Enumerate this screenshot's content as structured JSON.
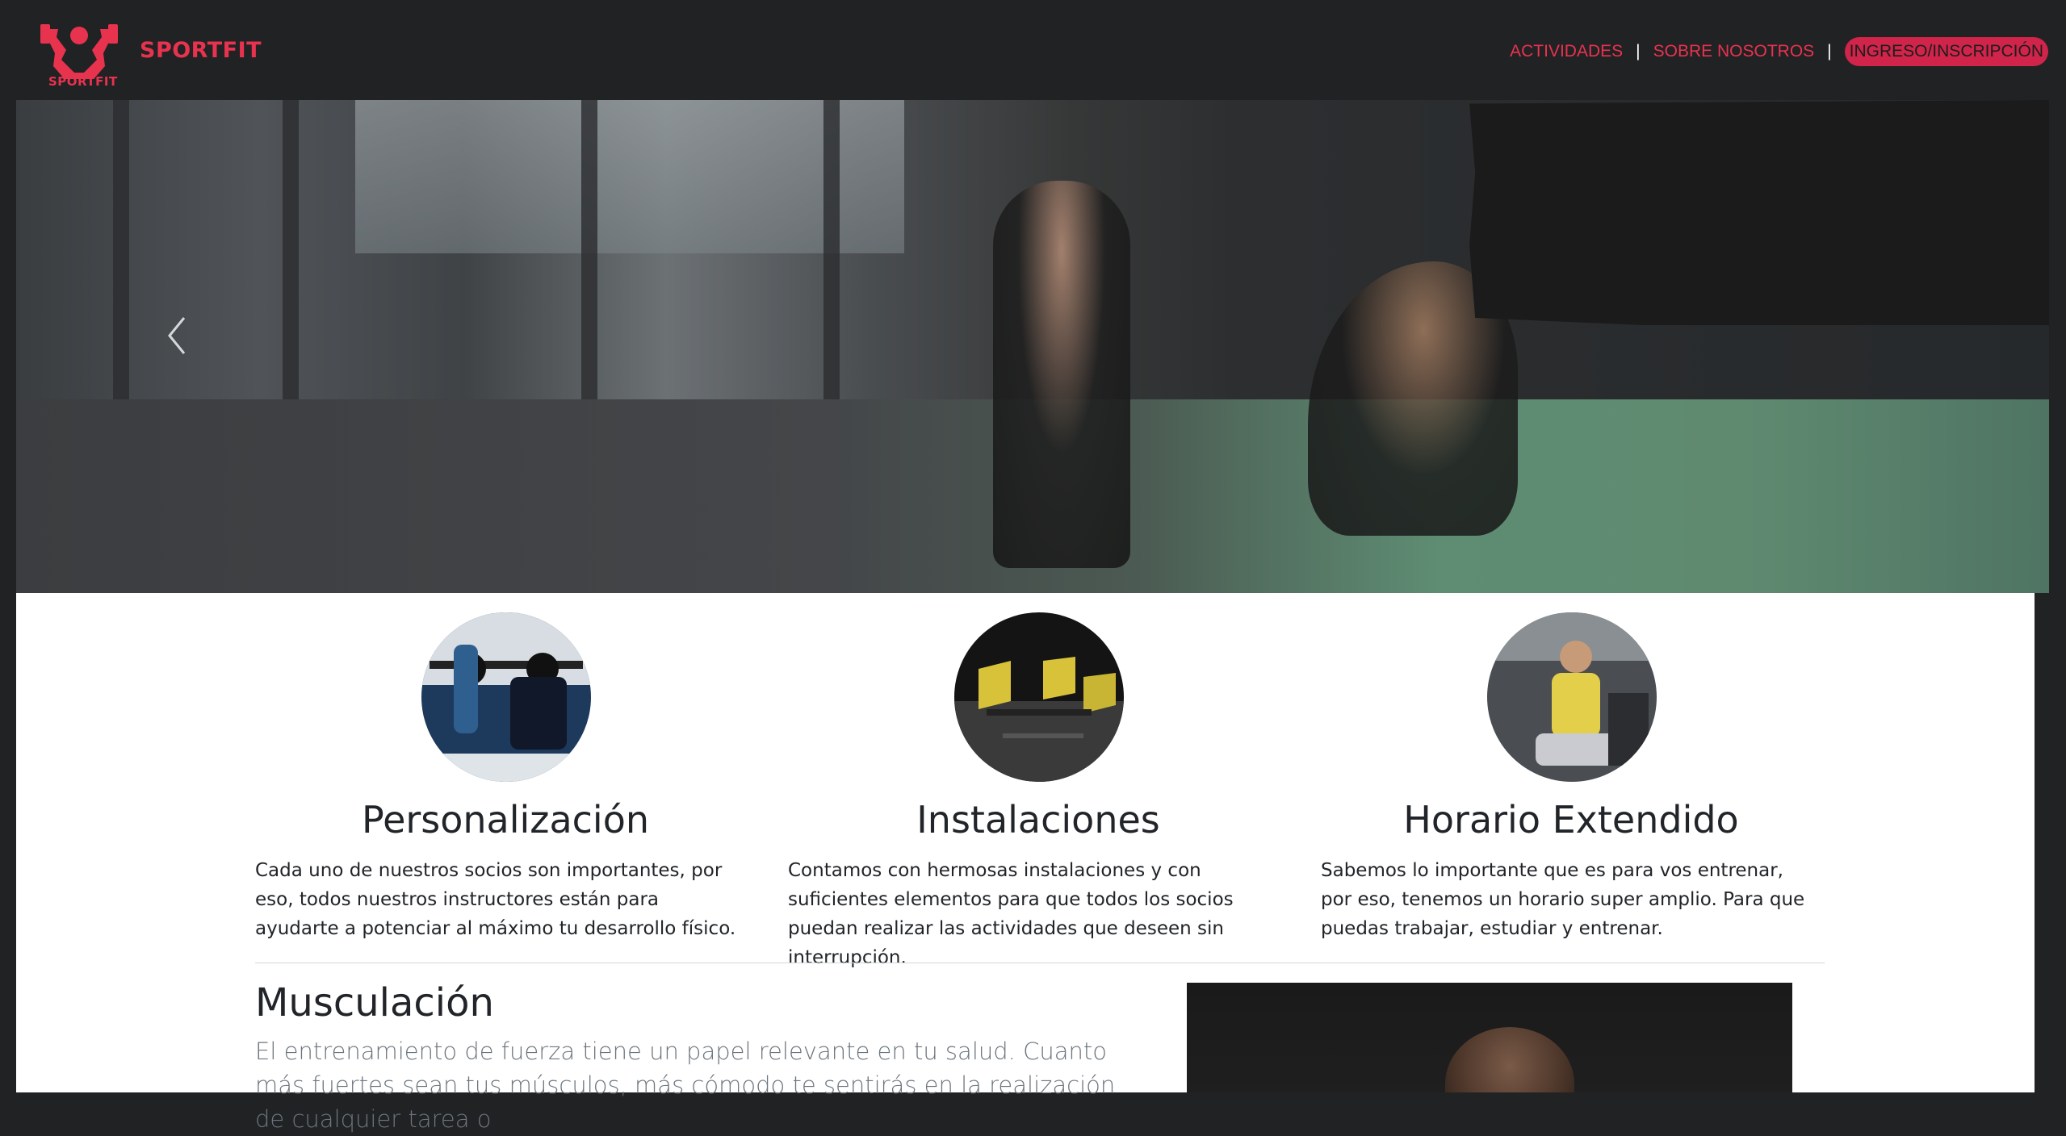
{
  "header": {
    "brand": "SPORTFIT",
    "logo_text": "SPORTFIT",
    "nav": [
      {
        "label": "ACTIVIDADES"
      },
      {
        "label": "SOBRE NOSOTROS"
      },
      {
        "label": "INGRESO/INSCRIPCIÓN"
      }
    ],
    "separator": "|"
  },
  "carousel": {
    "prev_icon": "chevron-left-icon"
  },
  "features": [
    {
      "title": "Personalización",
      "text": "Cada uno de nuestros socios son importantes, por eso, todos nuestros instructores están para ayudarte a potenciar al máximo tu desarrollo físico."
    },
    {
      "title": "Instalaciones",
      "text": "Contamos con hermosas instalaciones y con suficientes elementos para que todos los socios puedan realizar las actividades que deseen sin interrupción."
    },
    {
      "title": "Horario Extendido",
      "text": "Sabemos lo importante que es para vos entrenar, por eso, tenemos un horario super amplio. Para que puedas trabajar, estudiar y entrenar."
    }
  ],
  "section": {
    "title": "Musculación",
    "lead": "El entrenamiento de fuerza tiene un papel relevante en tu salud. Cuanto más fuertes sean tus músculos, más cómodo te sentirás en la realización de cualquier tarea o"
  },
  "colors": {
    "accent": "#e8334f",
    "cta_bg": "#d0244a",
    "navbar_bg": "#212224",
    "text": "#212529",
    "muted": "#6c757d"
  }
}
